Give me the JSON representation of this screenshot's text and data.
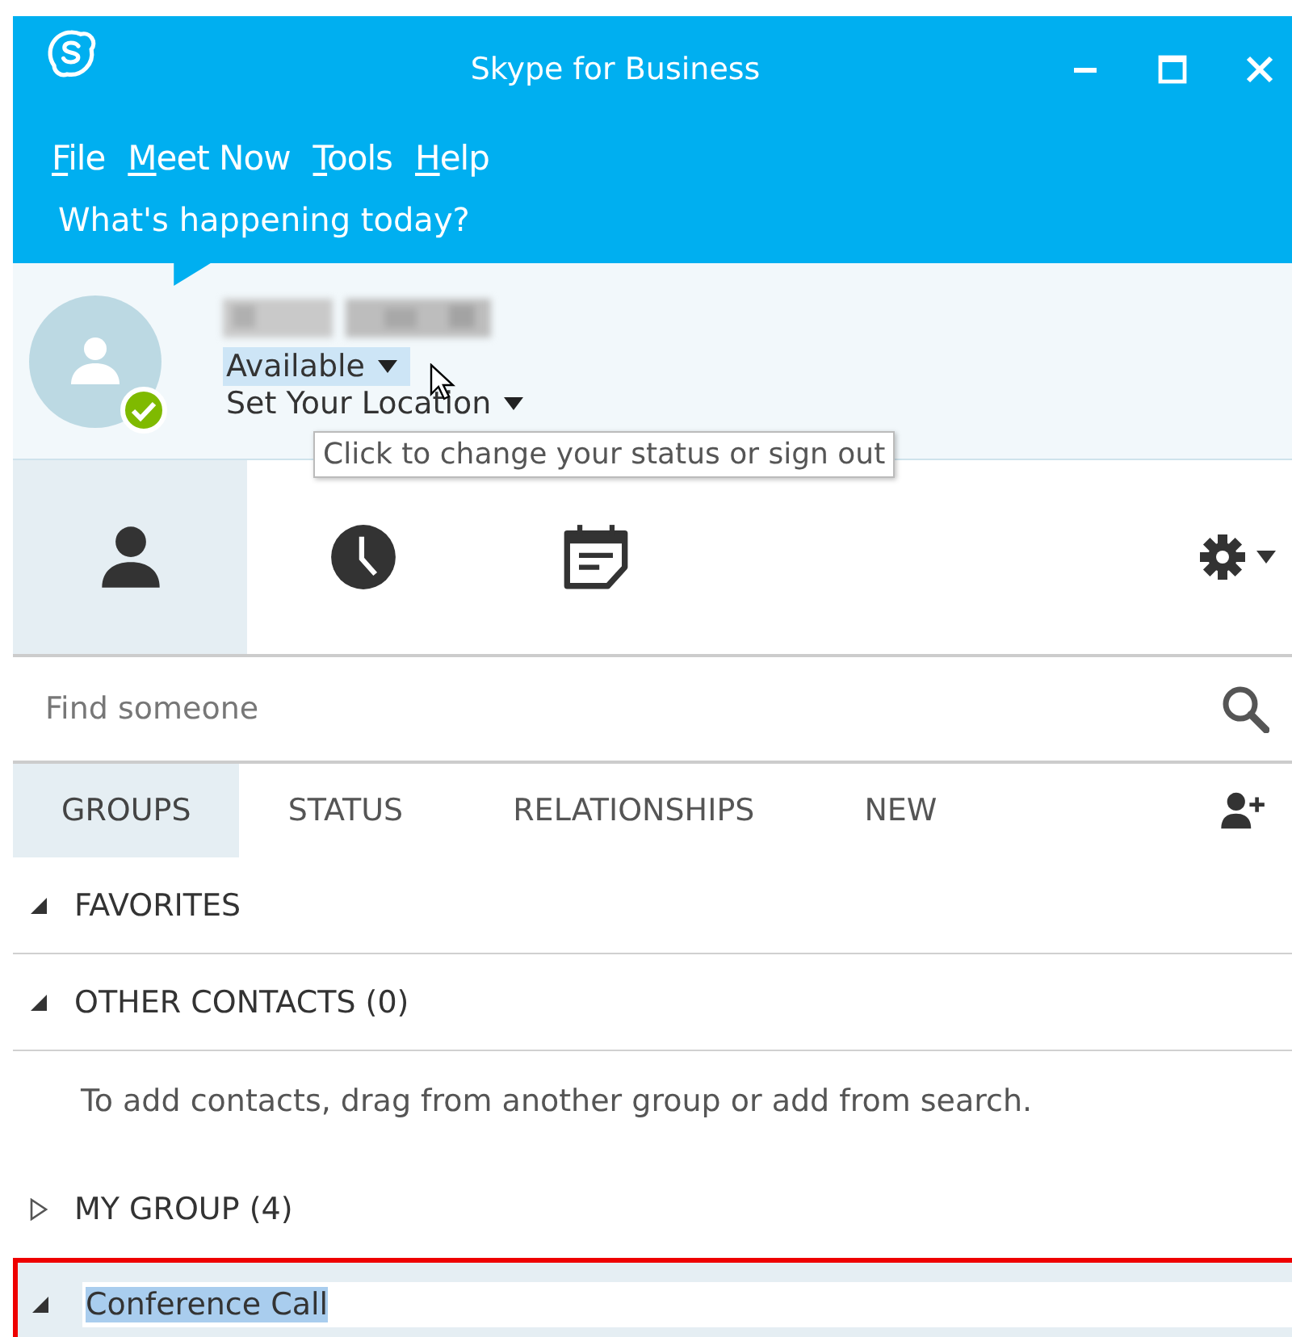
{
  "window": {
    "title": "Skype for Business"
  },
  "menu": [
    {
      "mnemonic": "F",
      "rest": "ile"
    },
    {
      "mnemonic": "M",
      "rest": "eet Now"
    },
    {
      "mnemonic": "T",
      "rest": "ools"
    },
    {
      "mnemonic": "H",
      "rest": "elp"
    }
  ],
  "mood_prompt": "What's happening today?",
  "profile": {
    "available": true,
    "status": "Available",
    "location": "Set Your Location",
    "tooltip": "Click to change your status or sign out"
  },
  "nav_tabs": [
    {
      "kind": "contacts",
      "selected": true
    },
    {
      "kind": "conversations",
      "selected": false
    },
    {
      "kind": "meetings",
      "selected": false
    }
  ],
  "search": {
    "placeholder": "Find someone"
  },
  "filter_tabs": [
    {
      "label": "GROUPS",
      "selected": true
    },
    {
      "label": "STATUS",
      "selected": false
    },
    {
      "label": "RELATIONSHIPS",
      "selected": false
    },
    {
      "label": "NEW",
      "selected": false
    }
  ],
  "groups": [
    {
      "kind": "header",
      "label": "FAVORITES",
      "expanded": true
    },
    {
      "kind": "header",
      "label": "OTHER CONTACTS (0)",
      "expanded": true,
      "hint": "To add contacts, drag from another group or add from search."
    },
    {
      "kind": "header",
      "label": "MY GROUP (4)",
      "expanded": false
    },
    {
      "kind": "editing",
      "label": "Conference Call",
      "expanded": true
    }
  ]
}
